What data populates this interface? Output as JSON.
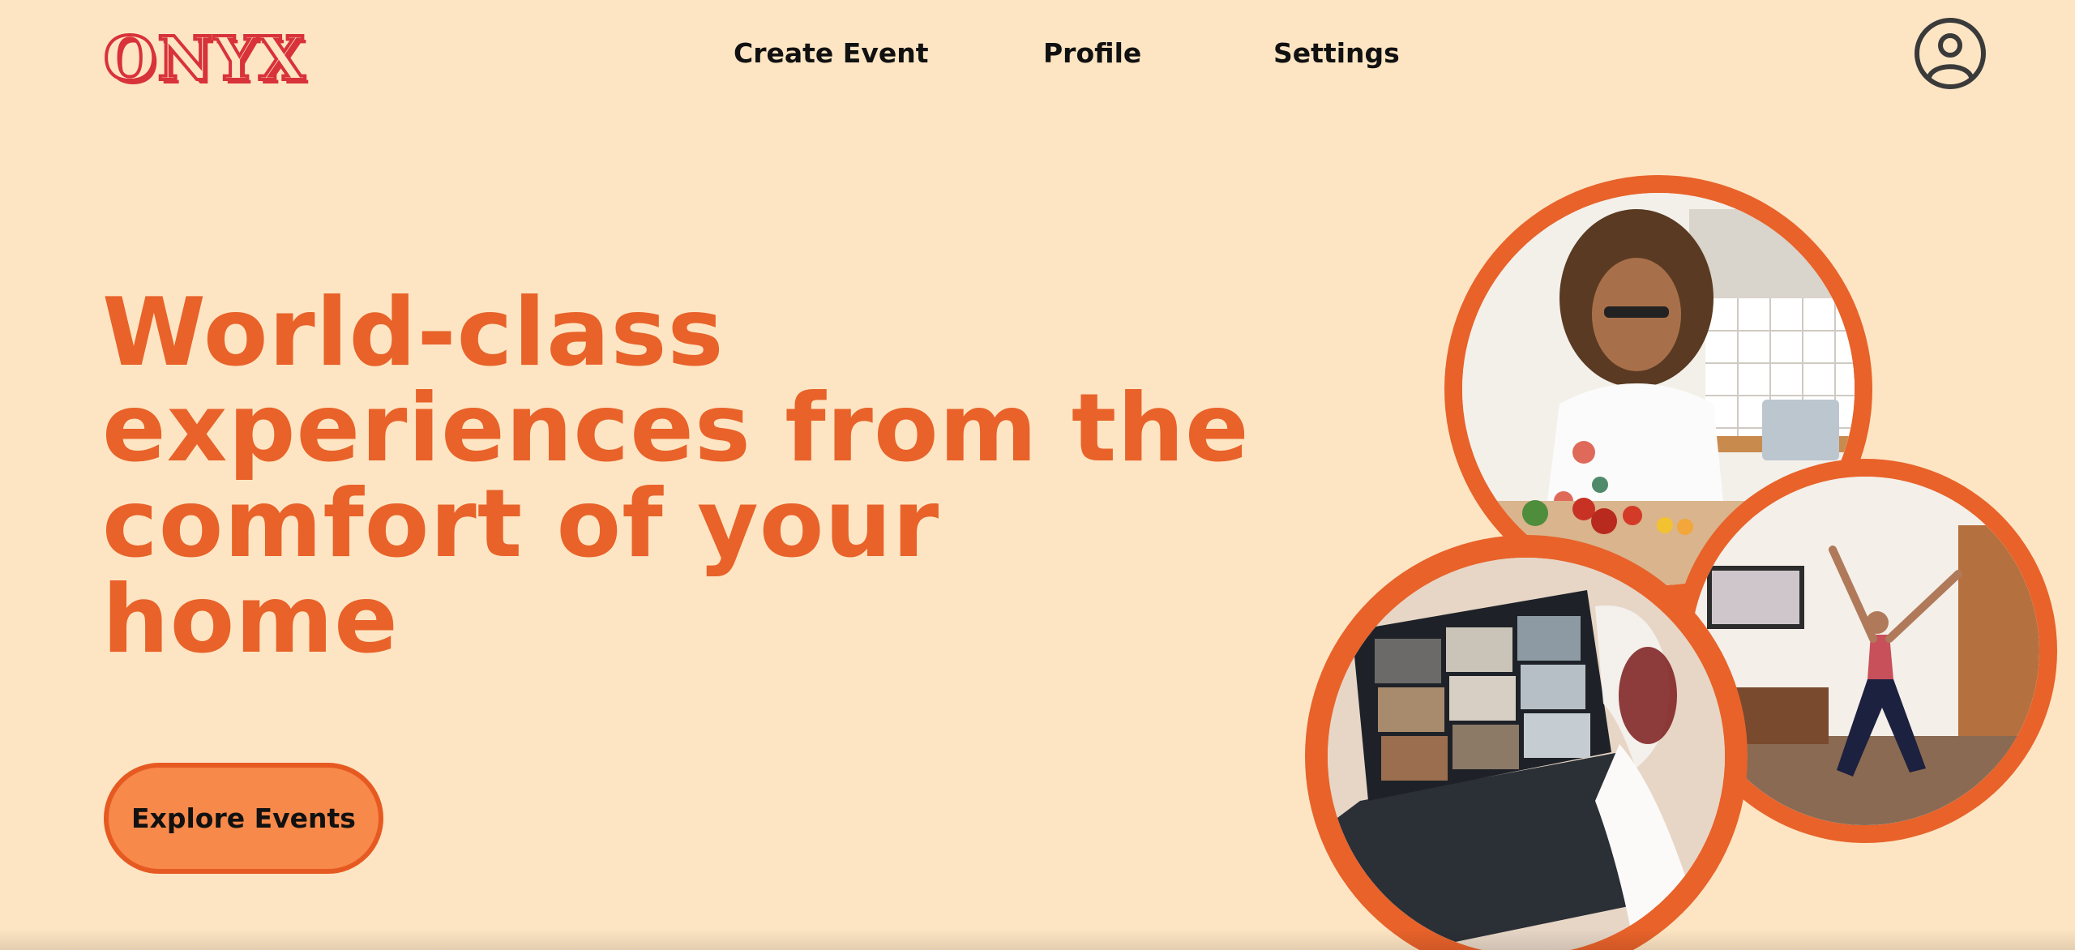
{
  "header": {
    "logo_text": "ONYX",
    "nav": {
      "create_event": "Create Event",
      "profile": "Profile",
      "settings": "Settings"
    },
    "avatar_icon": "user-circle-icon"
  },
  "hero": {
    "title": "World-class experiences from the comfort of your home",
    "cta_label": "Explore Events"
  },
  "images": [
    {
      "name": "woman-cooking-photo",
      "icon": "photo"
    },
    {
      "name": "video-call-wine-tasting-photo",
      "icon": "photo"
    },
    {
      "name": "woman-dance-workout-photo",
      "icon": "photo"
    }
  ],
  "colors": {
    "background": "#fde5c3",
    "accent_orange": "#e8622a",
    "button_fill": "#f7894a",
    "logo_red": "#d8323a",
    "text_dark": "#111111"
  }
}
